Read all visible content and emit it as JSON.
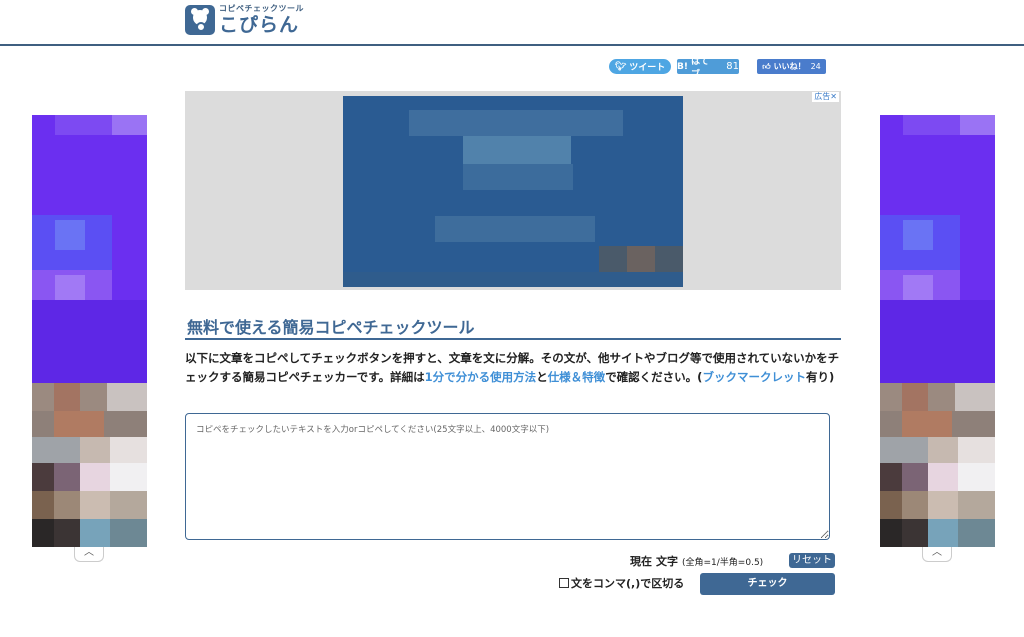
{
  "header": {
    "logo_sub": "コピペチェックツール",
    "logo_main": "こぴらん"
  },
  "social": {
    "tweet_label": "ツイート",
    "hateb_label": "はてブ",
    "hateb_icon": "B!",
    "hateb_count": "81",
    "like_label": "いいね！",
    "like_count": "24"
  },
  "ads": {
    "badge": "広告✕",
    "collapse_icon": "︿"
  },
  "main": {
    "title": "無料で使える簡易コピペチェックツール",
    "desc_part1": "以下に文章をコピペしてチェックボタンを押すと、文章を文に分解。その文が、他サイトやブログ等で使用されていないかをチェックする簡易コピペチェッカーです。詳細は",
    "link_usage": "1分で分かる使用方法",
    "desc_and": "と",
    "link_spec": "仕様＆特徴",
    "desc_part2": "で確認ください。(",
    "link_bookmarklet": "ブックマークレット",
    "desc_part3": "有り)",
    "textarea_placeholder": "コピペをチェックしたいテキストを入力orコピペしてください(25文字以上、4000文字以下)",
    "count_label": "現在",
    "count_unit": "文字",
    "count_note": "(全角=1/半角=0.5)",
    "reset_label": "リセット",
    "comma_label": "文をコンマ(,)で区切る",
    "check_label": "チェック"
  },
  "colors": {
    "accent": "#3f6894",
    "link": "#3f8fd6",
    "ad_purple": "#6b2ff0"
  }
}
